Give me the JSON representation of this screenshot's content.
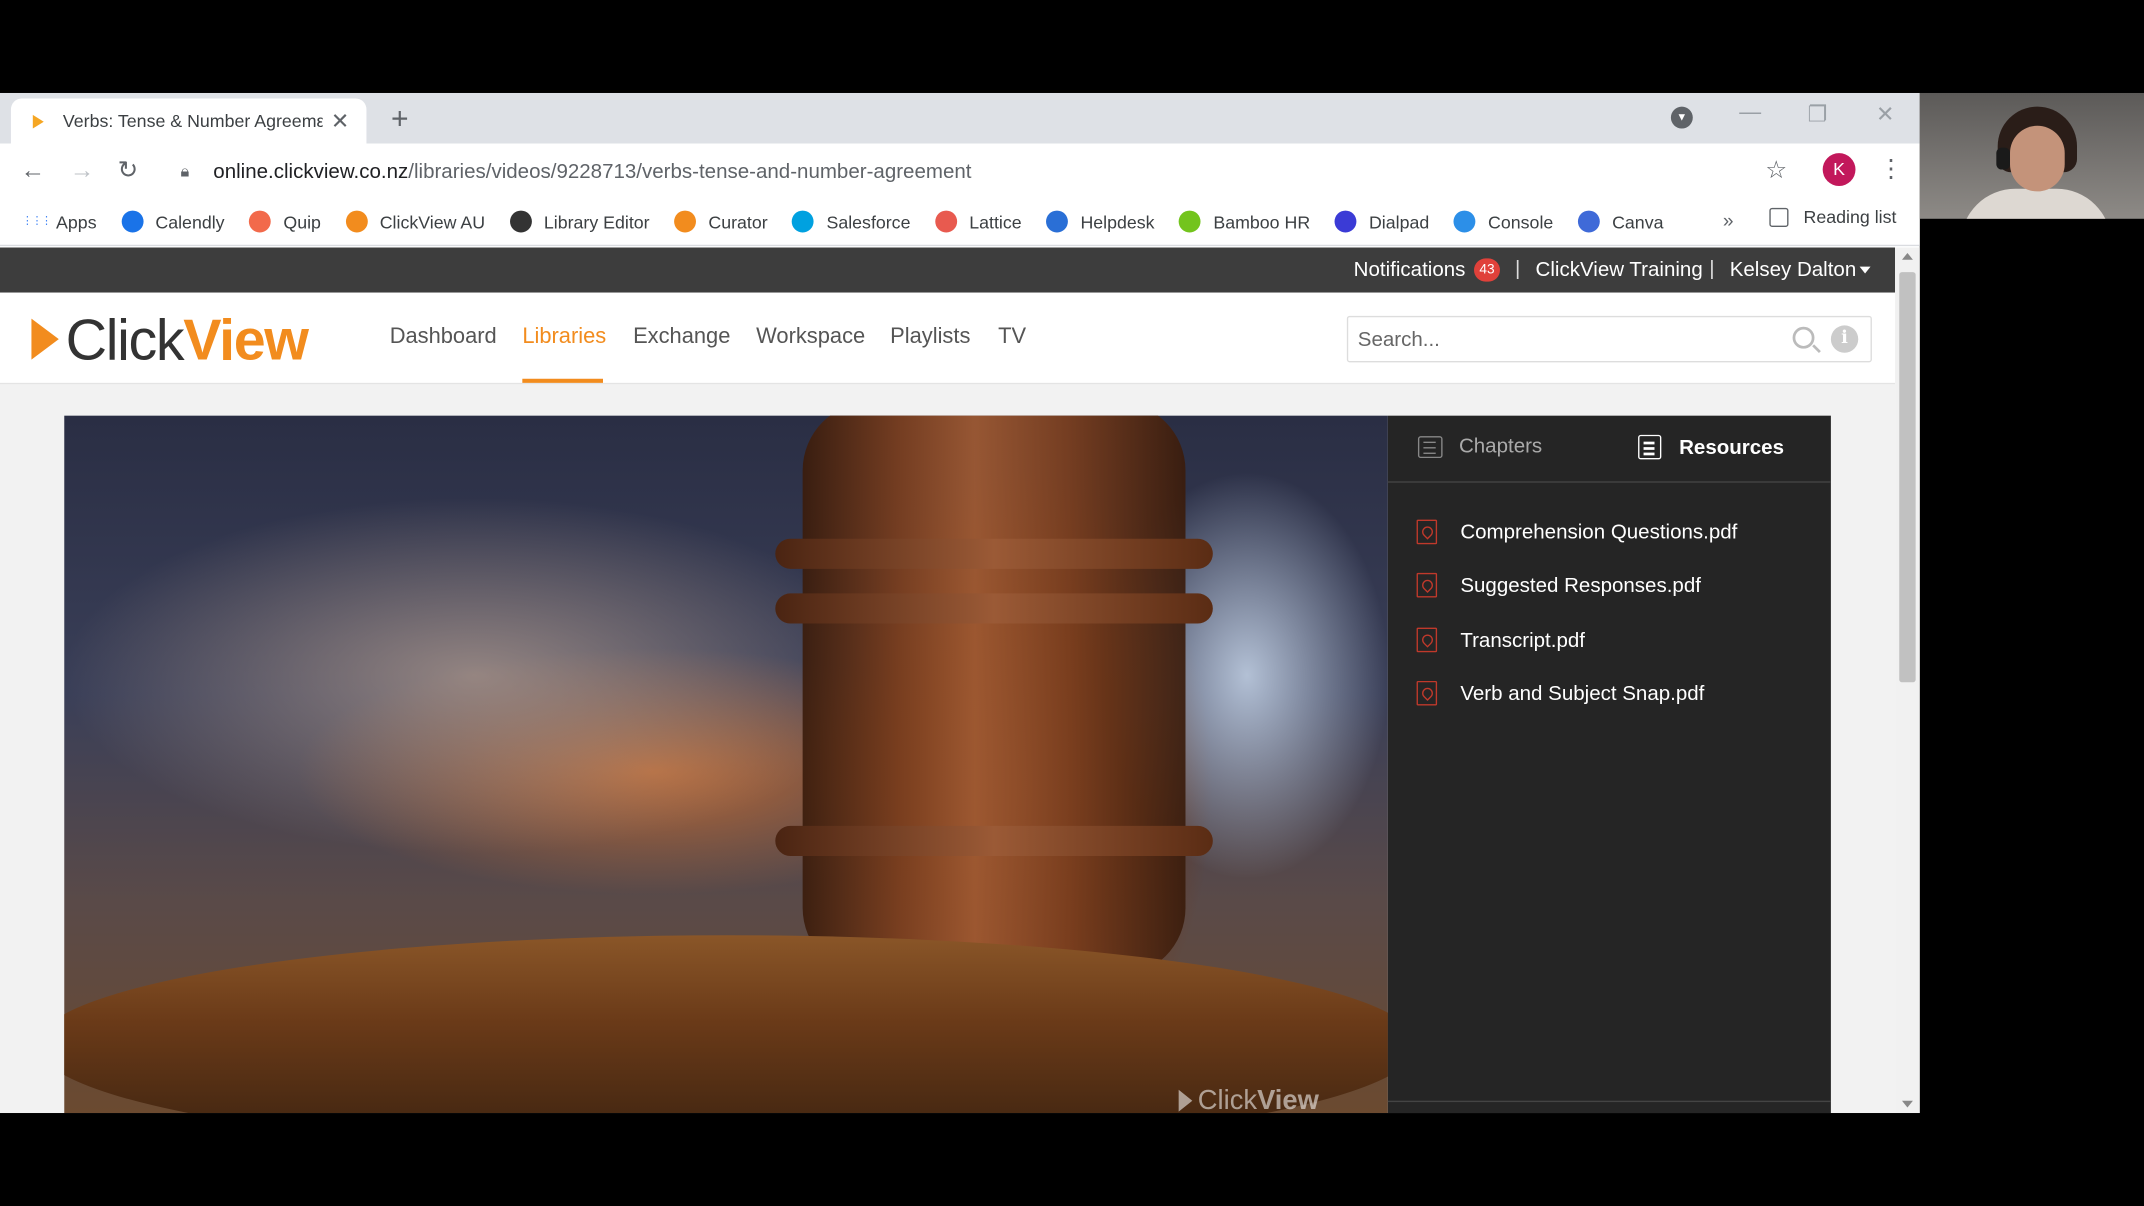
{
  "browser": {
    "tab_title": "Verbs: Tense & Number Agreemε",
    "url_host": "online.clickview.co.nz",
    "url_path": "/libraries/videos/9228713/verbs-tense-and-number-agreement",
    "profile_initial": "K",
    "new_tab": "+",
    "tab_close": "✕",
    "bookmarks": [
      {
        "label": "Apps",
        "icon": "apps-grid-icon",
        "color": "#4285f4"
      },
      {
        "label": "Calendly",
        "icon": "calendly-icon",
        "color": "#1a73e8"
      },
      {
        "label": "Quip",
        "icon": "quip-icon",
        "color": "#f26a4b"
      },
      {
        "label": "ClickView AU",
        "icon": "clickview-icon",
        "color": "#f28c1e"
      },
      {
        "label": "Library Editor",
        "icon": "library-editor-icon",
        "color": "#333333"
      },
      {
        "label": "Curator",
        "icon": "curator-icon",
        "color": "#f28c1e"
      },
      {
        "label": "Salesforce",
        "icon": "salesforce-icon",
        "color": "#00a1e0"
      },
      {
        "label": "Lattice",
        "icon": "lattice-icon",
        "color": "#e85a4f"
      },
      {
        "label": "Helpdesk",
        "icon": "helpdesk-icon",
        "color": "#2a6fd6"
      },
      {
        "label": "Bamboo HR",
        "icon": "bamboohr-icon",
        "color": "#73c41d"
      },
      {
        "label": "Dialpad",
        "icon": "dialpad-icon",
        "color": "#3b3bd6"
      },
      {
        "label": "Console",
        "icon": "console-icon",
        "color": "#2c8fe8"
      },
      {
        "label": "Canva",
        "icon": "canva-icon",
        "color": "#3f6ad8"
      }
    ],
    "more": "»",
    "reading_list": "Reading list"
  },
  "userbar": {
    "notifications": "Notifications",
    "notification_count": "43",
    "org": "ClickView Training",
    "user": "Kelsey Dalton",
    "separator": "|"
  },
  "header": {
    "logo_click": "Click",
    "logo_view": "View",
    "nav": [
      "Dashboard",
      "Libraries",
      "Exchange",
      "Workspace",
      "Playlists",
      "TV"
    ],
    "active_nav": "Libraries",
    "search_placeholder": "Search..."
  },
  "video": {
    "watermark_click": "Click",
    "watermark_view": "View"
  },
  "panel": {
    "tabs": [
      "Chapters",
      "Resources"
    ],
    "active_tab": "Resources",
    "resources": [
      "Comprehension Questions.pdf",
      "Suggested Responses.pdf",
      "Transcript.pdf",
      "Verb and Subject Snap.pdf"
    ]
  },
  "colors": {
    "accent": "#f28c1e",
    "badge": "#e0413a",
    "panel_bg": "#252525",
    "userbar_bg": "#3d3d3d"
  }
}
